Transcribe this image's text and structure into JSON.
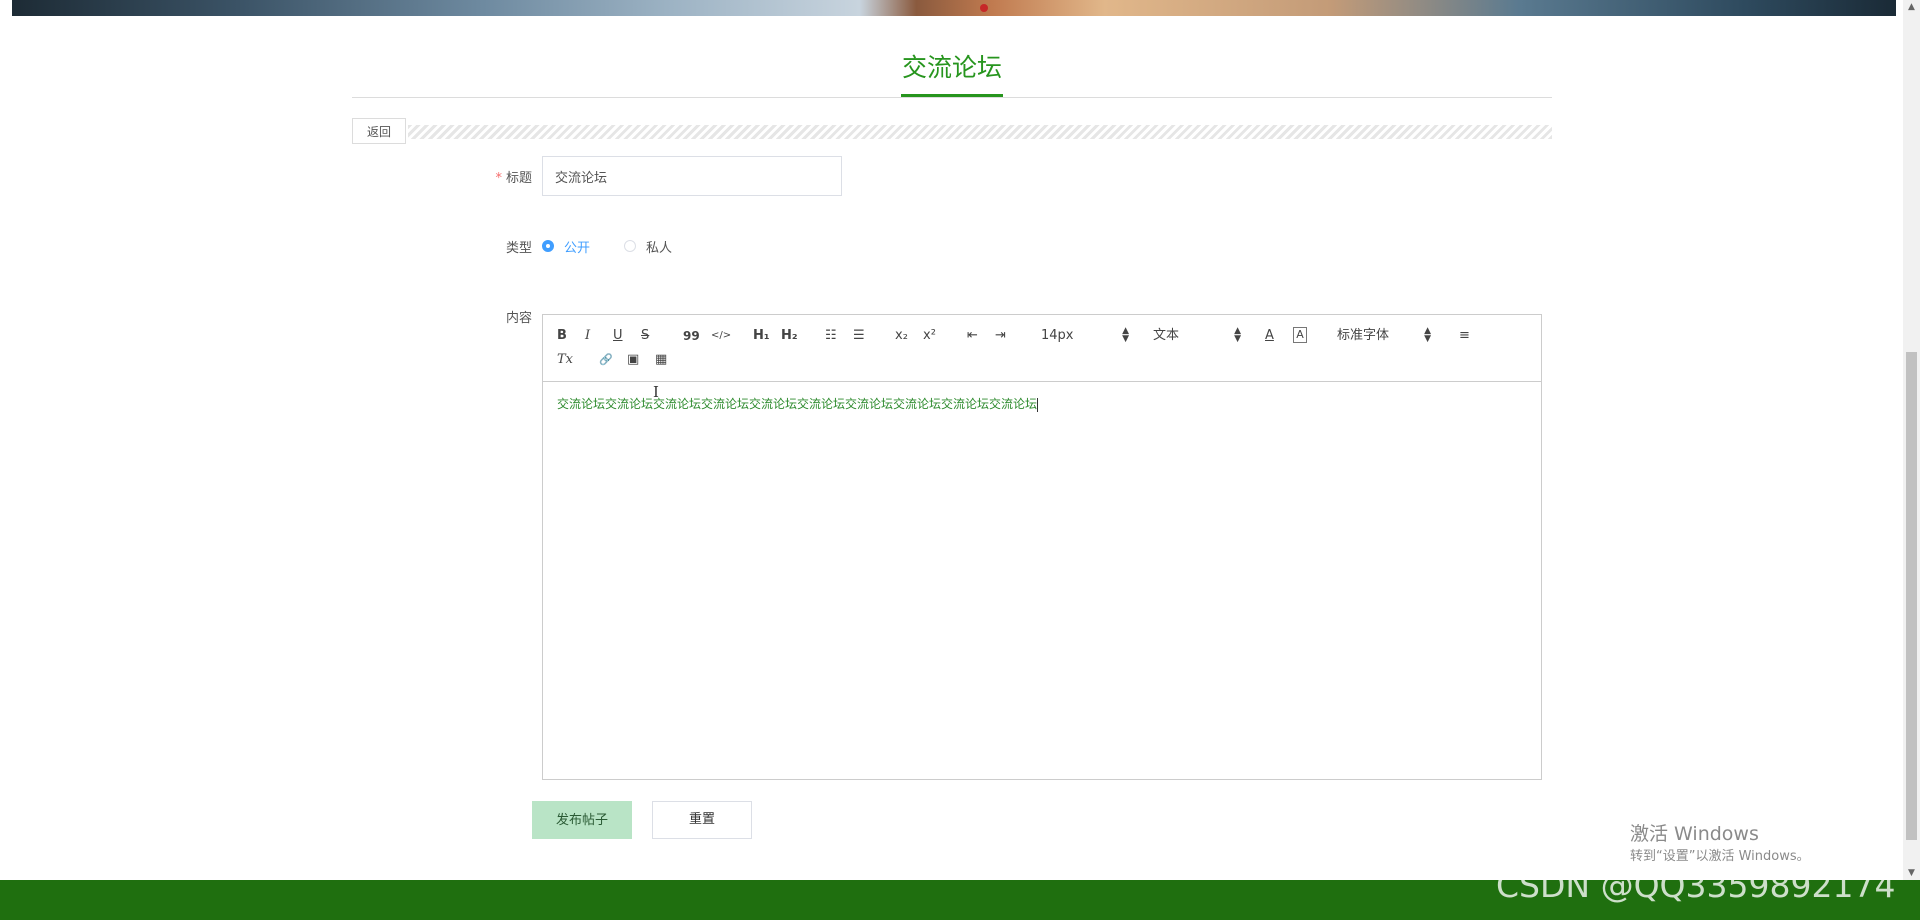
{
  "page": {
    "title": "交流论坛"
  },
  "back_button": {
    "label": "返回"
  },
  "form": {
    "title": {
      "required_mark": "*",
      "label": "标题",
      "value": "交流论坛"
    },
    "type": {
      "label": "类型",
      "options": [
        {
          "label": "公开",
          "checked": true
        },
        {
          "label": "私人",
          "checked": false
        }
      ]
    },
    "content": {
      "label": "内容",
      "toolbar": {
        "bold": "B",
        "italic": "I",
        "underline": "U",
        "strike": "S",
        "blockquote": "99",
        "code": "</>",
        "h1": "H₁",
        "h2": "H₂",
        "ordered_list": "☷",
        "bullet_list": "☰",
        "subscript": "x₂",
        "superscript": "x²",
        "outdent": "⇤",
        "indent": "⇥",
        "size": "14px",
        "header": "文本",
        "font": "标准字体",
        "color": "A",
        "background": "A",
        "align": "≡",
        "clean": "Tx",
        "link": "🔗",
        "image": "▣",
        "video": "▦"
      },
      "text": "交流论坛交流论坛交流论坛交流论坛交流论坛交流论坛交流论坛交流论坛交流论坛交流论坛"
    },
    "buttons": {
      "publish": "发布帖子",
      "reset": "重置"
    }
  },
  "watermarks": {
    "windows_line1": "激活 Windows",
    "windows_line2": "转到“设置”以激活 Windows。",
    "csdn": "CSDN @QQ3359892174"
  },
  "colors": {
    "accent": "#27951e",
    "footer": "#1f6f0f",
    "radio_active": "#409eff",
    "publish_bg": "#b9e4c6"
  }
}
